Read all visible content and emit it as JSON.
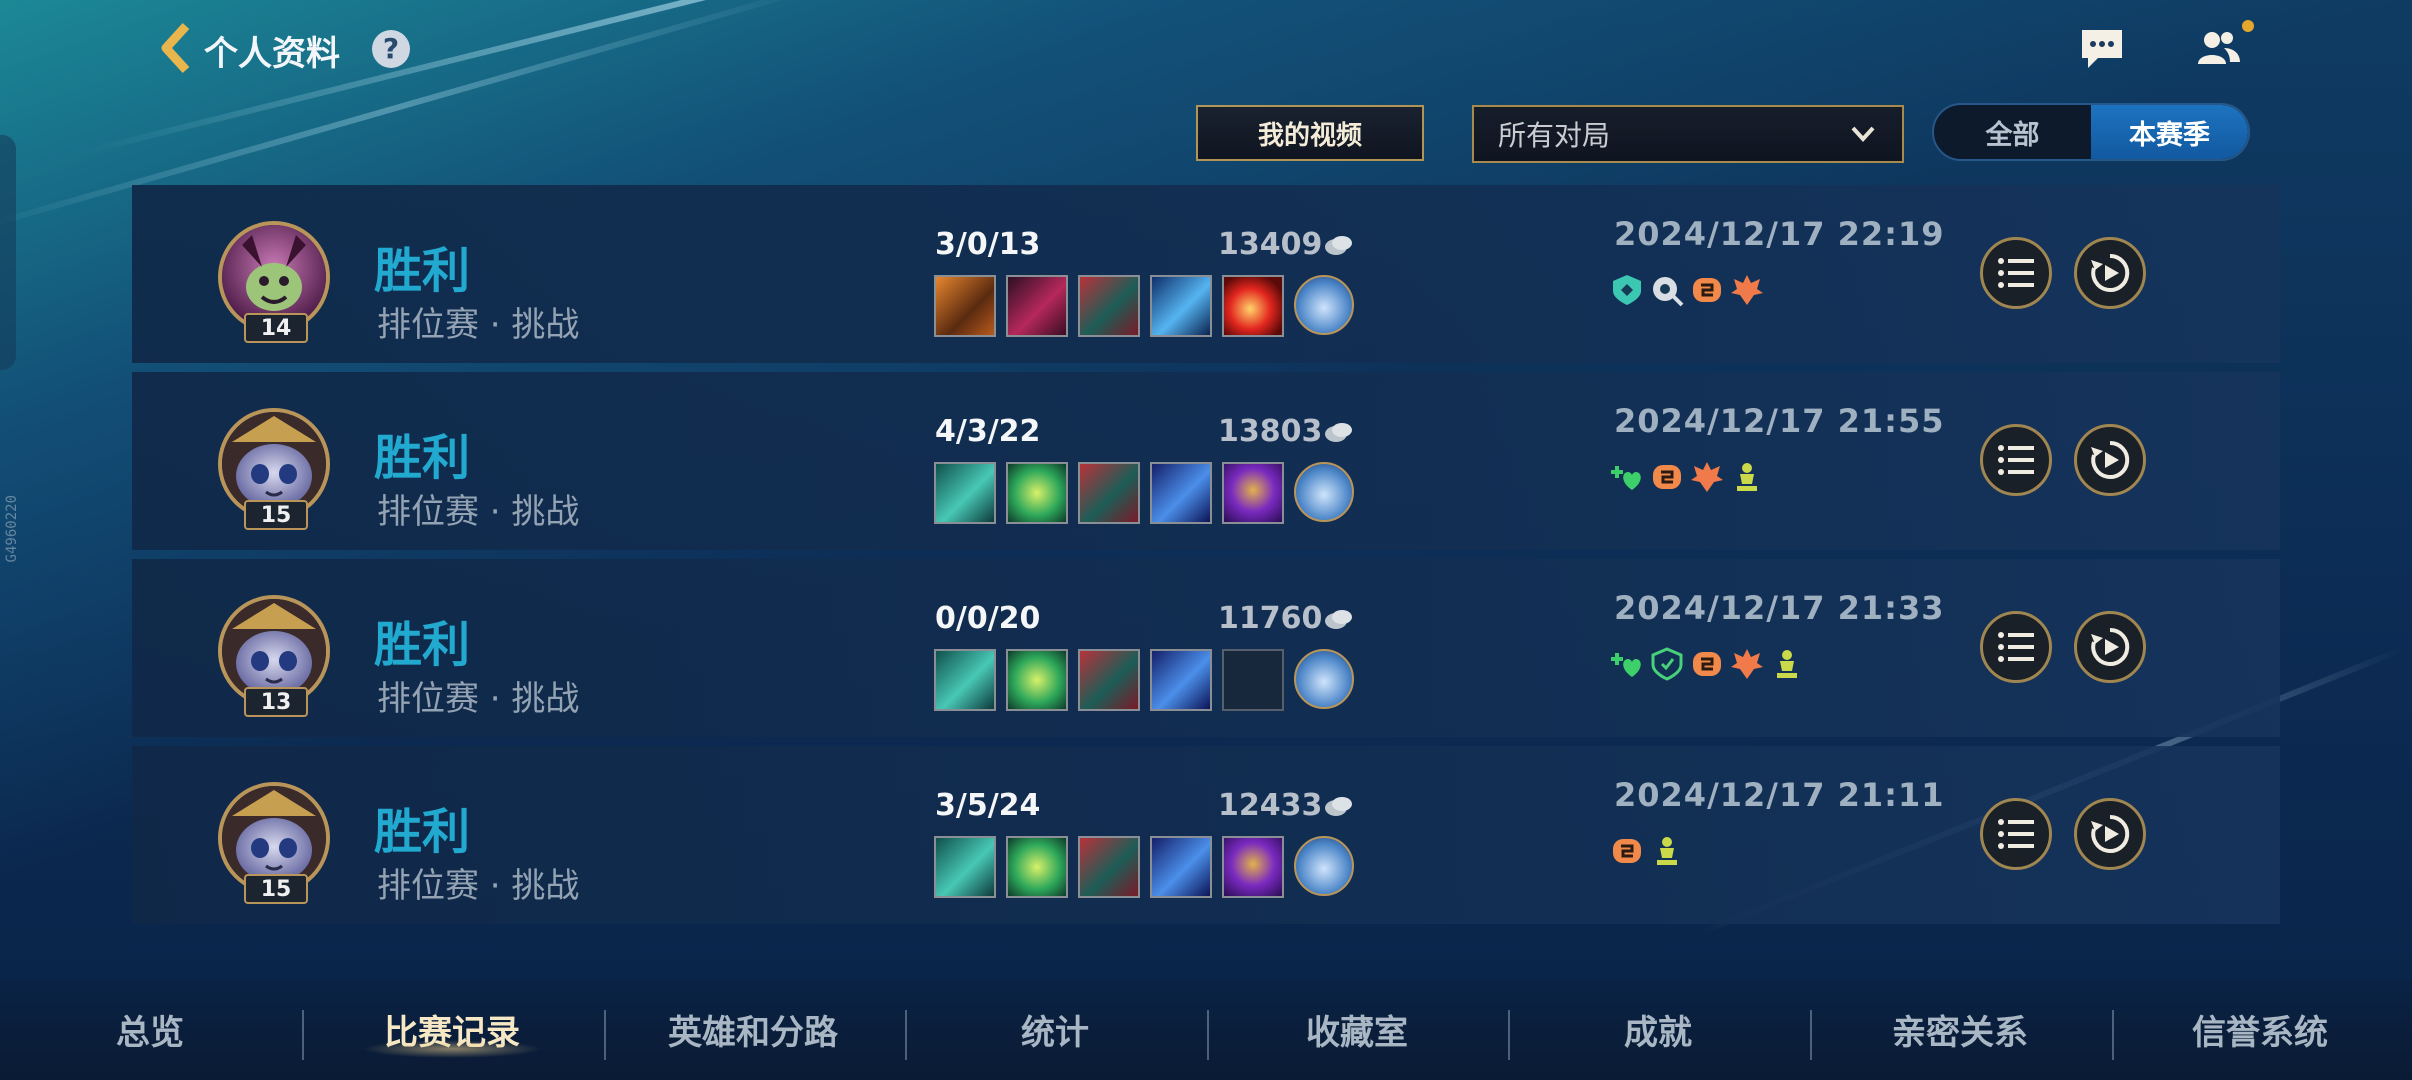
{
  "header": {
    "title": "个人资料",
    "help": "?"
  },
  "filters": {
    "my_videos": "我的视频",
    "match_filter": "所有对局",
    "toggle": [
      "全部",
      "本赛季"
    ],
    "toggle_active": "本赛季"
  },
  "side_text": "G4960220",
  "matches": [
    {
      "level": "14",
      "result": "胜利",
      "mode": "排位赛 · 挑战",
      "kda": "3/0/13",
      "gold": "13409",
      "date": "2024/12/17 22:19"
    },
    {
      "level": "15",
      "result": "胜利",
      "mode": "排位赛 · 挑战",
      "kda": "4/3/22",
      "gold": "13803",
      "date": "2024/12/17 21:55"
    },
    {
      "level": "13",
      "result": "胜利",
      "mode": "排位赛 · 挑战",
      "kda": "0/0/20",
      "gold": "11760",
      "date": "2024/12/17 21:33"
    },
    {
      "level": "15",
      "result": "胜利",
      "mode": "排位赛 · 挑战",
      "kda": "3/5/24",
      "gold": "12433",
      "date": "2024/12/17 21:11"
    }
  ],
  "nav": {
    "tabs": [
      "总览",
      "比赛记录",
      "英雄和分路",
      "统计",
      "收藏室",
      "成就",
      "亲密关系",
      "信誉系统"
    ],
    "active": "比赛记录"
  },
  "colors": {
    "win": "#22a9d0",
    "gold_border": "#b9955a",
    "toggle_active": "#1d73c0"
  }
}
